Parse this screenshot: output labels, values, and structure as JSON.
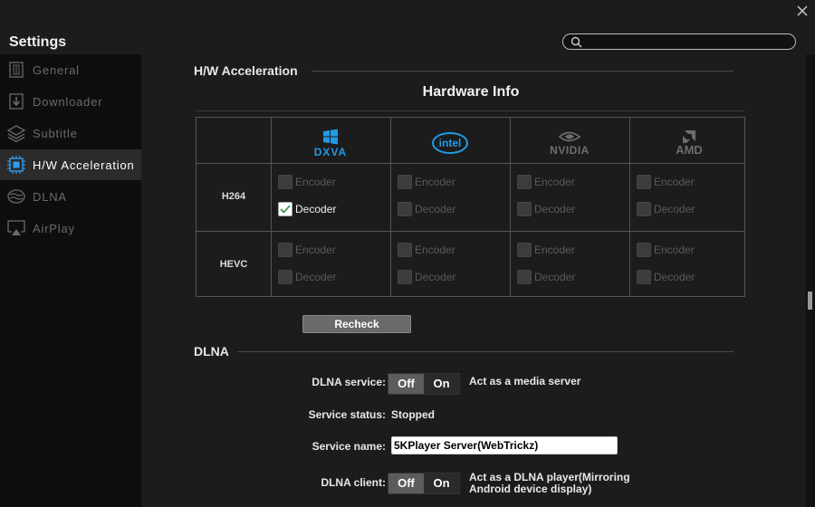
{
  "window": {
    "title": "Settings"
  },
  "search": {
    "placeholder": "",
    "value": ""
  },
  "sidebar": {
    "items": [
      {
        "label": "General",
        "icon": "general-icon"
      },
      {
        "label": "Downloader",
        "icon": "downloader-icon"
      },
      {
        "label": "Subtitle",
        "icon": "subtitle-icon"
      },
      {
        "label": "H/W Acceleration",
        "icon": "chip-icon",
        "active": true
      },
      {
        "label": "DLNA",
        "icon": "dlna-icon"
      },
      {
        "label": "AirPlay",
        "icon": "airplay-icon"
      }
    ]
  },
  "hw": {
    "section_title": "H/W Acceleration",
    "table_title": "Hardware Info",
    "vendors": [
      "DXVA",
      "intel",
      "NVIDIA",
      "AMD"
    ],
    "rows": [
      {
        "codec": "H264",
        "cells": [
          {
            "encoder": false,
            "decoder": true,
            "enabled": true
          },
          {
            "encoder": false,
            "decoder": false,
            "enabled": false
          },
          {
            "encoder": false,
            "decoder": false,
            "enabled": false
          },
          {
            "encoder": false,
            "decoder": false,
            "enabled": false
          }
        ]
      },
      {
        "codec": "HEVC",
        "cells": [
          {
            "encoder": false,
            "decoder": false,
            "enabled": false
          },
          {
            "encoder": false,
            "decoder": false,
            "enabled": false
          },
          {
            "encoder": false,
            "decoder": false,
            "enabled": false
          },
          {
            "encoder": false,
            "decoder": false,
            "enabled": false
          }
        ]
      }
    ],
    "encoder_label": "Encoder",
    "decoder_label": "Decoder",
    "recheck_label": "Recheck"
  },
  "dlna": {
    "section_title": "DLNA",
    "service_label": "DLNA service:",
    "service_off": "Off",
    "service_on": "On",
    "service_state": "Off",
    "service_desc": "Act as a media server",
    "status_label": "Service status:",
    "status_value": "Stopped",
    "name_label": "Service name:",
    "name_value": "5KPlayer Server(WebTrickz)",
    "client_label": "DLNA client:",
    "client_off": "Off",
    "client_on": "On",
    "client_state": "Off",
    "client_desc_line1": "Act as a DLNA player(Mirroring",
    "client_desc_line2": "Android device display)"
  },
  "colors": {
    "dxva_blue": "#1e9be8",
    "intel_blue": "#1e9be8",
    "vendor_gray": "#6e6e6e"
  }
}
